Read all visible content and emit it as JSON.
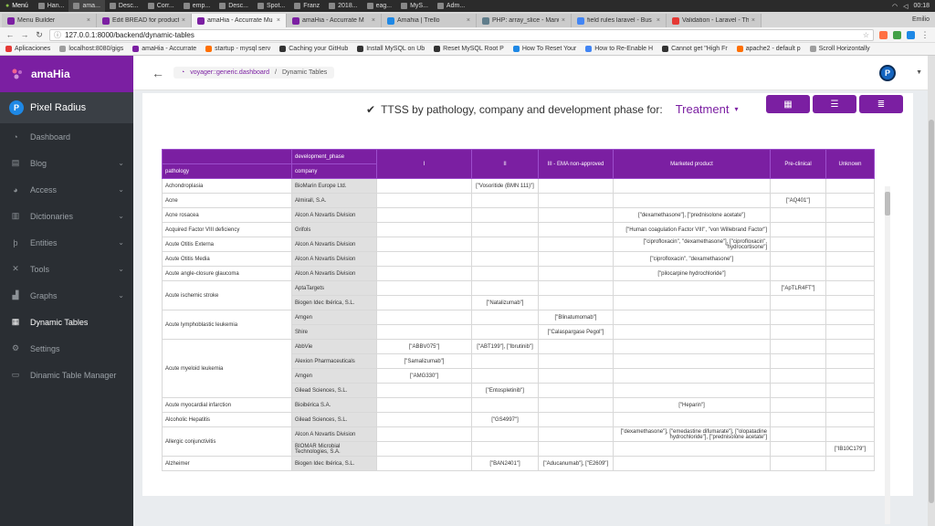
{
  "taskbar": {
    "menu": "Menú",
    "items": [
      "Han...",
      "ama...",
      "Desc...",
      "Corr...",
      "emp...",
      "Desc...",
      "Spot...",
      "Franz",
      "2018...",
      "eag...",
      "MyS...",
      "Adm..."
    ],
    "clock": "00:18"
  },
  "tabs": [
    {
      "label": "Menu Builder",
      "color": "#7b1fa2"
    },
    {
      "label": "Edit BREAD for product",
      "color": "#7b1fa2"
    },
    {
      "label": "amaHia - Accurrate Mu",
      "color": "#7b1fa2",
      "active": true
    },
    {
      "label": "amaHia - Accurrate M",
      "color": "#7b1fa2"
    },
    {
      "label": "Amahia | Trello",
      "color": "#1e88e5"
    },
    {
      "label": "PHP: array_slice - Manu",
      "color": "#607d8b"
    },
    {
      "label": "field rules laravel - Bus",
      "color": "#4285f4"
    },
    {
      "label": "Validation - Laravel - Th",
      "color": "#e53935"
    }
  ],
  "tab_user": "Emilio",
  "address": {
    "url": "127.0.0.1:8000/backend/dynamic-tables"
  },
  "bookmarks": [
    {
      "label": "Aplicaciones",
      "color": "#e53935"
    },
    {
      "label": "localhost:8080/gigs",
      "color": "#9e9e9e"
    },
    {
      "label": "amaHia - Accurrate",
      "color": "#7b1fa2"
    },
    {
      "label": "startup - mysql serv",
      "color": "#ff6f00"
    },
    {
      "label": "Caching your GitHub",
      "color": "#333333"
    },
    {
      "label": "Install MySQL on Ub",
      "color": "#333333"
    },
    {
      "label": "Reset MySQL Root P",
      "color": "#333333"
    },
    {
      "label": "How To Reset Your",
      "color": "#1e88e5"
    },
    {
      "label": "How to Re-Enable H",
      "color": "#4285f4"
    },
    {
      "label": "Cannot get \"High Fr",
      "color": "#333333"
    },
    {
      "label": "apache2 - default p",
      "color": "#ff6f00"
    },
    {
      "label": "Scroll Horizontally",
      "color": "#9e9e9e"
    }
  ],
  "sidebar": {
    "brand": "amaHia",
    "profile": "Pixel Radius",
    "profile_initial": "P",
    "items": [
      {
        "label": "Dashboard",
        "icon": "speedometer-icon",
        "glyph": "◔",
        "chev": false
      },
      {
        "label": "Blog",
        "icon": "newspaper-icon",
        "glyph": "▤",
        "chev": true
      },
      {
        "label": "Access",
        "icon": "pie-icon",
        "glyph": "◕",
        "chev": true
      },
      {
        "label": "Dictionaries",
        "icon": "book-icon",
        "glyph": "▥",
        "chev": true
      },
      {
        "label": "Entities",
        "icon": "tag-icon",
        "glyph": "þ",
        "chev": true
      },
      {
        "label": "Tools",
        "icon": "tools-icon",
        "glyph": "✕",
        "chev": true
      },
      {
        "label": "Graphs",
        "icon": "bar-chart-icon",
        "glyph": "▟",
        "chev": true
      },
      {
        "label": "Dynamic Tables",
        "icon": "table-icon",
        "glyph": "▦",
        "chev": false,
        "active": true
      },
      {
        "label": "Settings",
        "icon": "gear-icon",
        "glyph": "⚙",
        "chev": false
      },
      {
        "label": "Dinamic Table Manager",
        "icon": "window-icon",
        "glyph": "▭",
        "chev": false
      }
    ]
  },
  "breadcrumb": {
    "first": "voyager::generic.dashboard",
    "second": "Dynamic Tables"
  },
  "user_initial": "P",
  "heading": {
    "text": "TTSS by pathology, company and development phase for:",
    "selected": "Treatment"
  },
  "table": {
    "top_header": "development_phase",
    "sub_headers": [
      "pathology",
      "company"
    ],
    "phases": [
      "I",
      "II",
      "III - EMA non-approved",
      "Marketed product",
      "Pre-clinical",
      "Unknown"
    ],
    "rows": [
      {
        "pathology": "Achondroplasia",
        "company": "BioMarin Europe Ltd.",
        "cells": [
          "",
          "[\"Vosoritide (BMN 111)\"]",
          "",
          "",
          "",
          ""
        ]
      },
      {
        "pathology": "Acne",
        "company": "Almirall, S.A.",
        "cells": [
          "",
          "",
          "",
          "",
          "[\"AQ401\"]",
          ""
        ]
      },
      {
        "pathology": "Acne rosacea",
        "company": "Alcon A Novartis Division",
        "cells": [
          "",
          "",
          "",
          "[\"dexamethasone\"], [\"prednisolone acetate\"]",
          "",
          ""
        ]
      },
      {
        "pathology": "Acquired Factor VIII deficiency",
        "company": "Grifols",
        "cells": [
          "",
          "",
          "",
          "[\"Human coagulation Factor VIII\", \"von Willebrand Factor\"]",
          "",
          ""
        ]
      },
      {
        "pathology": "Acute Otitis Externa",
        "company": "Alcon A Novartis Division",
        "cells": [
          "",
          "",
          "",
          "[\"ciprofloxacin\", \"dexamethasone\"], [\"ciprofloxacin\", \"hydrocortisone\"]",
          "",
          ""
        ]
      },
      {
        "pathology": "Acute Otitis Media",
        "company": "Alcon A Novartis Division",
        "cells": [
          "",
          "",
          "",
          "[\"ciprofloxacin\", \"dexamethasone\"]",
          "",
          ""
        ]
      },
      {
        "pathology": "Acute angle-closure glaucoma",
        "company": "Alcon A Novartis Division",
        "cells": [
          "",
          "",
          "",
          "[\"pilocarpine hydrochloride\"]",
          "",
          ""
        ]
      },
      {
        "pathology": "Acute ischemic stroke",
        "company": "AptaTargets",
        "cells": [
          "",
          "",
          "",
          "",
          "[\"ApTLR4FT\"]",
          ""
        ]
      },
      {
        "pathology": "",
        "company": "Biogen Idec Ibérica, S.L.",
        "cells": [
          "",
          "[\"Natalizumab\"]",
          "",
          "",
          "",
          ""
        ]
      },
      {
        "pathology": "Acute lymphoblastic leukemia",
        "company": "Amgen",
        "cells": [
          "",
          "",
          "[\"Blinatumomab\"]",
          "",
          "",
          ""
        ]
      },
      {
        "pathology": "",
        "company": "Shire",
        "cells": [
          "",
          "",
          "[\"Calaspargase Pegol\"]",
          "",
          "",
          ""
        ]
      },
      {
        "pathology": "Acute myeloid leukemia",
        "company": "AbbVie",
        "cells": [
          "[\"ABBV075\"]",
          "[\"ABT199\"], [\"Ibrutinib\"]",
          "",
          "",
          "",
          ""
        ]
      },
      {
        "pathology": "",
        "company": "Alexion Pharmaceuticals",
        "cells": [
          "[\"Samalizumab\"]",
          "",
          "",
          "",
          "",
          ""
        ]
      },
      {
        "pathology": "",
        "company": "Amgen",
        "cells": [
          "[\"AMG330\"]",
          "",
          "",
          "",
          "",
          ""
        ]
      },
      {
        "pathology": "",
        "company": "Gilead Sciences, S.L.",
        "cells": [
          "",
          "[\"Entospletinib\"]",
          "",
          "",
          "",
          ""
        ]
      },
      {
        "pathology": "Acute myocardial infarction",
        "company": "Bioibérica S.A.",
        "cells": [
          "",
          "",
          "",
          "[\"Heparin\"]",
          "",
          ""
        ]
      },
      {
        "pathology": "Alcoholic Hepatitis",
        "company": "Gilead Sciences, S.L.",
        "cells": [
          "",
          "[\"GS4997\"]",
          "",
          "",
          "",
          ""
        ]
      },
      {
        "pathology": "Allergic conjunctivitis",
        "company": "Alcon A Novartis Division",
        "cells": [
          "",
          "",
          "",
          "[\"dexamethasone\"], [\"emedastine difumarate\"], [\"olopatadine hydrochloride\"], [\"prednisolone acetate\"]",
          "",
          ""
        ]
      },
      {
        "pathology": "",
        "company": "BIOMAR Microbial Technologies, S.A.",
        "cells": [
          "",
          "",
          "",
          "",
          "",
          "[\"IB10C179\"]"
        ]
      },
      {
        "pathology": "Alzheimer",
        "company": "Biogen Idec Ibérica, S.L.",
        "cells": [
          "",
          "[\"BAN2401\"]",
          "[\"Aducanumab\"], [\"E2609\"]",
          "",
          "",
          ""
        ]
      }
    ]
  }
}
